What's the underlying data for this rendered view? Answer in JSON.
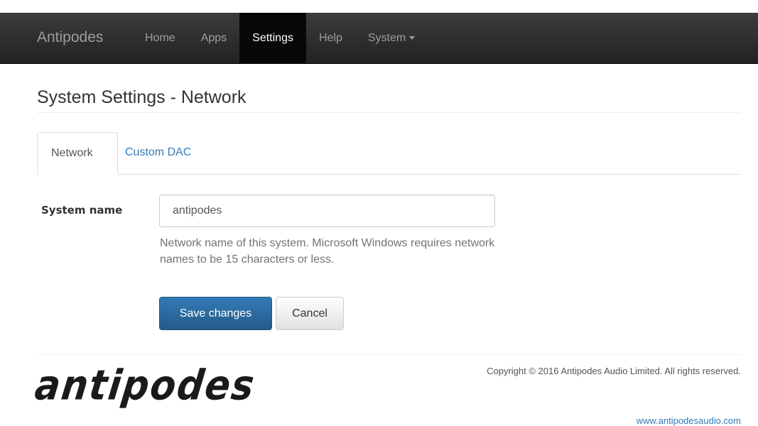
{
  "navbar": {
    "brand": "Antipodes",
    "items": [
      {
        "label": "Home"
      },
      {
        "label": "Apps"
      },
      {
        "label": "Settings"
      },
      {
        "label": "Help"
      },
      {
        "label": "System"
      }
    ],
    "active": "Settings"
  },
  "page": {
    "title": "System Settings - Network"
  },
  "tabs": [
    {
      "label": "Network",
      "active": true
    },
    {
      "label": "Custom DAC",
      "active": false
    }
  ],
  "form": {
    "system_name_label": "System name",
    "system_name_value": "antipodes",
    "help_text": "Network name of this system. Microsoft Windows requires network names to be 15 characters or less.",
    "save_label": "Save changes",
    "cancel_label": "Cancel"
  },
  "footer": {
    "logo_text": "antipodes",
    "copyright": "Copyright © 2016 Antipodes Audio Limited. All rights reserved.",
    "website": "www.antipodesaudio.com"
  },
  "colors": {
    "navbar_bg": "#222222",
    "link": "#337ab7",
    "primary_button": "#337ab7"
  }
}
